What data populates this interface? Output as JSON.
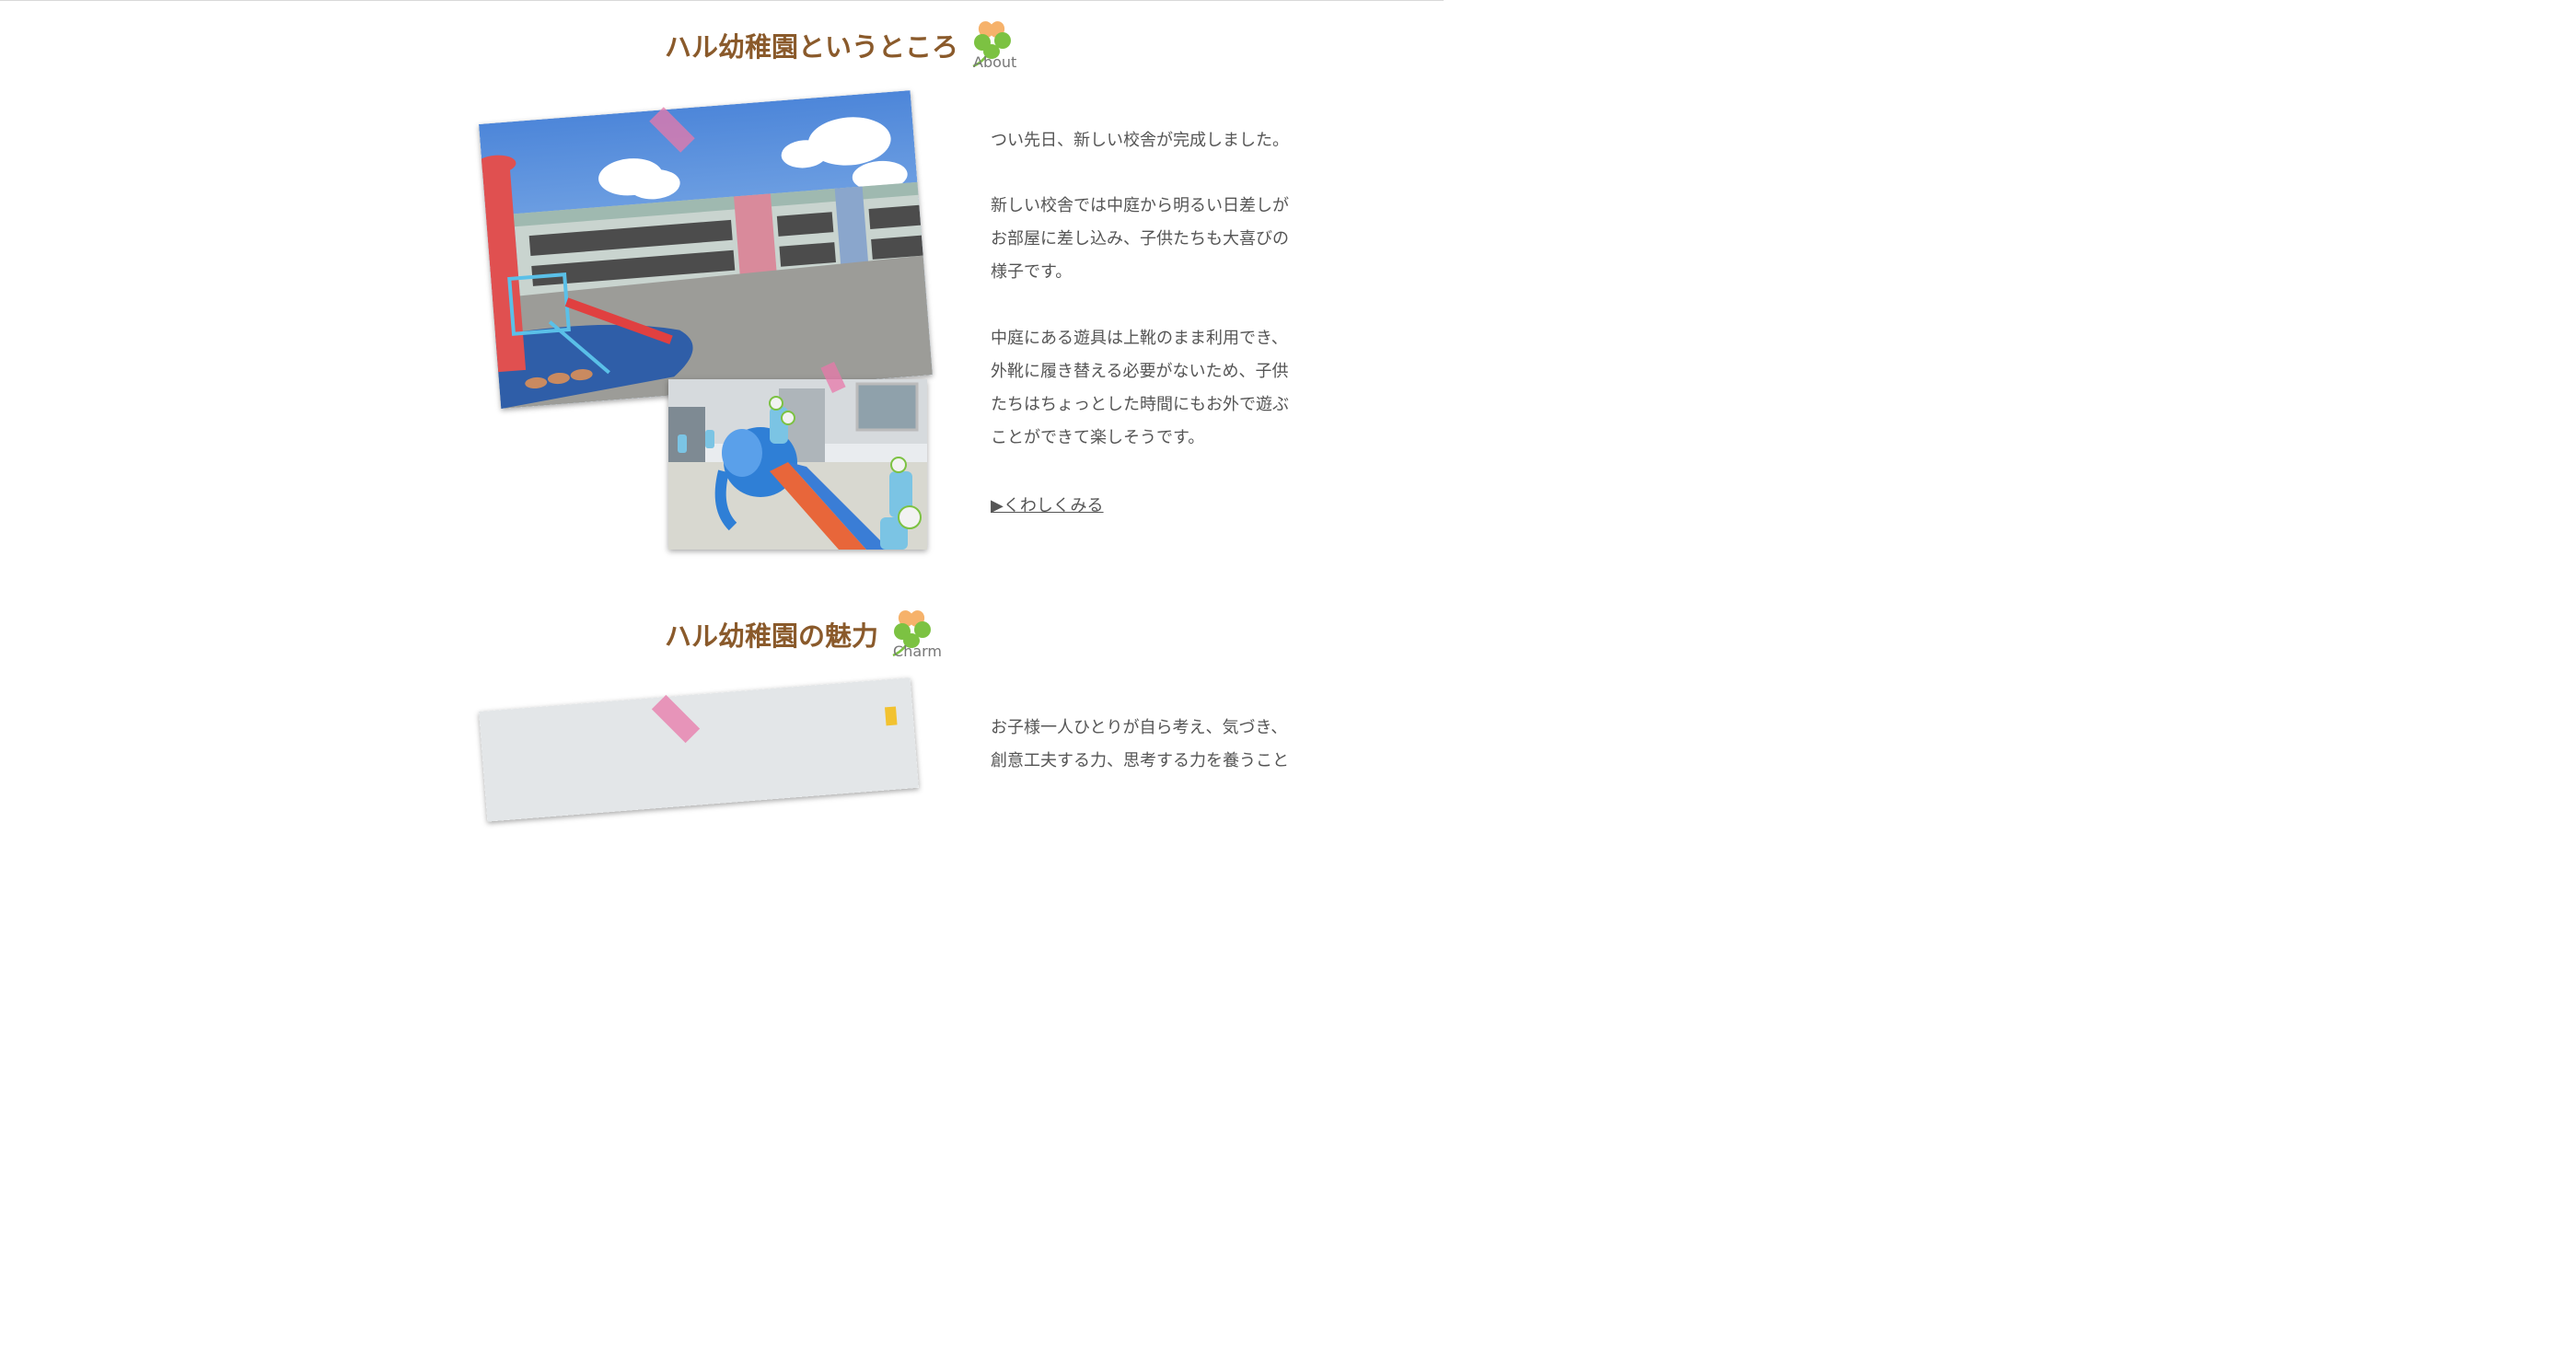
{
  "about": {
    "title": "ハル幼稚園というところ",
    "title_word": "About",
    "paragraphs": [
      [
        "つい先日、新しい校舎が完成しました。"
      ],
      [
        "新しい校舎では中庭から明るい日差しが",
        "お部屋に差し込み、子供たちも大喜びの",
        "様子です。"
      ],
      [
        "中庭にある遊具は上靴のまま利用でき、",
        "外靴に履き替える必要がないため、子供",
        "たちはちょっとした時間にもお外で遊ぶ",
        "ことができて楽しそうです。"
      ]
    ],
    "more_link": "▶くわしくみる"
  },
  "charm": {
    "title": "ハル幼稚園の魅力",
    "title_word": "Charm",
    "paragraphs": [
      [
        "お子様一人ひとりが自ら考え、気づき、",
        "創意工夫する力、思考する力を養うこと"
      ]
    ]
  },
  "icons": {
    "about_clover": "clover-icon",
    "charm_clover": "clover-icon"
  },
  "colors": {
    "title": "#8a5a2b",
    "clover_green": "#7cc242",
    "clover_orange": "#f6b26b",
    "tape_pink": "#e878aa"
  }
}
